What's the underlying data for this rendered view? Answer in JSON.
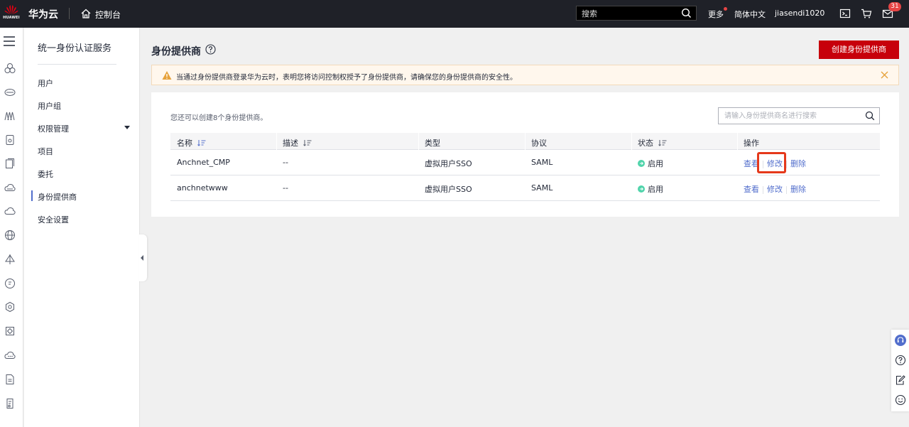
{
  "topbar": {
    "logo_text": "HUAWEI",
    "brand": "华为云",
    "console": "控制台",
    "search_placeholder": "搜索",
    "more": "更多",
    "language": "简体中文",
    "username": "jiasendi1020",
    "message_count": "31",
    "icons": [
      "home-icon",
      "search-icon",
      "terminal-icon",
      "cart-icon",
      "mail-icon"
    ]
  },
  "rail": {
    "icons": [
      "menu-icon",
      "cloud-service-icon",
      "cloud-storage-icon",
      "network-icon",
      "file-icon",
      "document-icon",
      "cloud-icon",
      "cloud-outline-icon",
      "globe-icon",
      "gateway-icon",
      "chat-icon",
      "settings-icon",
      "shield-icon",
      "cloud-cluster-icon",
      "doc-icon",
      "script-icon"
    ]
  },
  "sidemenu": {
    "title": "统一身份认证服务",
    "items": [
      {
        "label": "用户"
      },
      {
        "label": "用户组"
      },
      {
        "label": "权限管理"
      },
      {
        "label": "项目"
      },
      {
        "label": "委托"
      },
      {
        "label": "身份提供商"
      },
      {
        "label": "安全设置"
      }
    ],
    "active": "身份提供商"
  },
  "main": {
    "title": "身份提供商",
    "create_button": "创建身份提供商",
    "alert": "当通过身份提供商登录华为云时，表明您将访问控制权授予了身份提供商，请确保您的身份提供商的安全性。",
    "quota": "您还可以创建8个身份提供商。",
    "search_placeholder": "请输入身份提供商名进行搜索",
    "columns": [
      "名称",
      "描述",
      "类型",
      "协议",
      "状态",
      "操作"
    ],
    "rows": [
      {
        "name": "Anchnet_CMP",
        "desc": "--",
        "type": "虚拟用户SSO",
        "protocol": "SAML",
        "status": "启用",
        "actions": [
          "查看",
          "修改",
          "删除"
        ]
      },
      {
        "name": "anchnetwww",
        "desc": "--",
        "type": "虚拟用户SSO",
        "protocol": "SAML",
        "status": "启用",
        "actions": [
          "查看",
          "修改",
          "删除"
        ]
      }
    ]
  },
  "colors": {
    "topbar_bg": "#1f2128",
    "primary_red": "#c7000b",
    "link_blue": "#526ecc",
    "status_green": "#50d4ab",
    "warning_bg": "#fff7ed",
    "warning_icon": "#e6a23c",
    "highlight_border": "#e5391b"
  }
}
